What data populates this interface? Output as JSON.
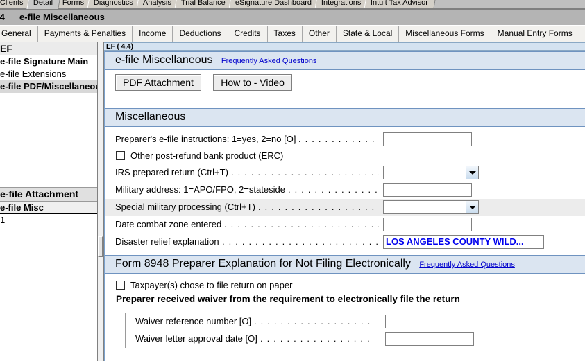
{
  "window": {
    "top_tabs": [
      {
        "label": "Clients",
        "selected": false
      },
      {
        "label": "Detail",
        "selected": true
      },
      {
        "label": "Forms",
        "selected": false
      },
      {
        "label": "Diagnostics",
        "selected": false
      },
      {
        "label": "Analysis",
        "selected": false
      },
      {
        "label": "Trial Balance",
        "selected": false
      },
      {
        "label": "eSignature Dashboard",
        "selected": false
      },
      {
        "label": "Integrations",
        "selected": false
      },
      {
        "label": "Intuit Tax Advisor",
        "selected": false
      }
    ],
    "title_number": ".4",
    "title_text": "e-file Miscellaneous"
  },
  "subtabs": [
    {
      "label": "General"
    },
    {
      "label": "Payments & Penalties"
    },
    {
      "label": "Income"
    },
    {
      "label": "Deductions"
    },
    {
      "label": "Credits"
    },
    {
      "label": "Taxes"
    },
    {
      "label": "Other"
    },
    {
      "label": "State & Local"
    },
    {
      "label": "Miscellaneous Forms"
    },
    {
      "label": "Manual Entry Forms"
    }
  ],
  "sidebar": {
    "header": "EF",
    "items": [
      {
        "label": "e-file Signature Main",
        "selected": false,
        "bold": true
      },
      {
        "label": "e-file Extensions",
        "selected": false,
        "bold": false
      },
      {
        "label": "e-file PDF/Miscellaneous",
        "selected": true,
        "bold": true
      }
    ],
    "sub_header": "e-file Attachment",
    "sub_item": "e-file Misc",
    "count": "1"
  },
  "main": {
    "ef_tab_label": "EF  ( 4.4)",
    "section1": {
      "title": "e-file Miscellaneous",
      "faq_link": "Frequently Asked Questions",
      "buttons": [
        {
          "label": "PDF Attachment"
        },
        {
          "label": "How to - Video"
        }
      ]
    },
    "section2": {
      "title": "Miscellaneous",
      "rows": [
        {
          "label": "Preparer's e-file instructions: 1=yes, 2=no [O]",
          "dots": ". . . . . . . . . . . . . .",
          "type": "text",
          "value": "",
          "highlight": false
        },
        {
          "label": "Other post-refund bank product (ERC)",
          "type": "checkbox",
          "checked": false
        },
        {
          "label": "IRS prepared return (Ctrl+T)",
          "dots": ". . . . . . . . . . . . . . . . . . . . . . .",
          "type": "combo",
          "value": "",
          "highlight": false
        },
        {
          "label": "Military address: 1=APO/FPO, 2=stateside",
          "dots": ". . . . . . . . . . . . . .",
          "type": "text",
          "value": "",
          "highlight": false
        },
        {
          "label": "Special military processing (Ctrl+T)",
          "dots": ". . . . . . . . . . . . . . . . . . . .",
          "type": "combo",
          "value": "",
          "highlight": true
        },
        {
          "label": "Date combat zone entered",
          "dots": ". . . . . . . . . . . . . . . . . . . . . . . .",
          "type": "text",
          "value": "",
          "highlight": false
        },
        {
          "label": "Disaster relief explanation",
          "dots": ". . . . . . . . . . . . . . . . . . . . . . . .",
          "type": "text",
          "value": "LOS ANGELES COUNTY WILD...",
          "value_color": "#0000ee",
          "highlight": false
        }
      ]
    },
    "section3": {
      "title": "Form 8948 Preparer Explanation for Not Filing Electronically",
      "faq_link": "Frequently Asked Questions",
      "checkbox_label": "Taxpayer(s) chose to file return on paper",
      "checkbox_checked": false,
      "bold_heading": "Preparer received waiver from the requirement to electronically file the return",
      "rows": [
        {
          "label": "Waiver reference number [O]",
          "dots": ". . . . . . . . . . . . . . . . . .",
          "type": "text",
          "value": "",
          "wide": true
        },
        {
          "label": "Waiver letter approval date [O]",
          "dots": ". . . . . . . . . . . . . . . . .",
          "type": "text",
          "value": "",
          "wide": false
        }
      ]
    }
  },
  "colors": {
    "section_header_bg": "#dbe5f1",
    "section_header_border": "#6f93c0",
    "link": "#0000cc",
    "value_blue": "#0000ee",
    "highlight_row": "#ececec"
  }
}
